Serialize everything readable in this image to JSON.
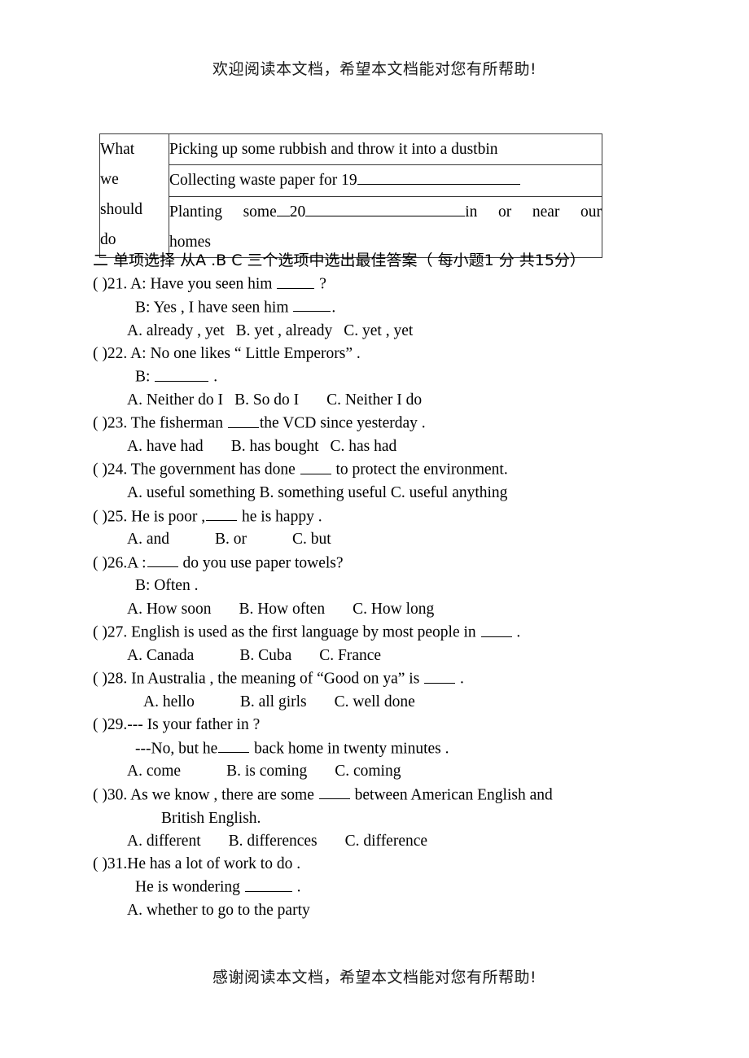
{
  "banner": {
    "top": "欢迎阅读本文档，希望本文档能对您有所帮助!",
    "bottom": "感谢阅读本文档，希望本文档能对您有所帮助!"
  },
  "table": {
    "left_header_lines": [
      "What",
      "we",
      "should",
      "do"
    ],
    "rows": [
      {
        "prefix": "Picking  up some rubbish and throw it into a dustbin",
        "blank": "",
        "suffix": ""
      },
      {
        "prefix": "Collecting waste paper for 19",
        "blank": "",
        "suffix": ""
      },
      {
        "prefix": "Planting  some",
        "number": "20",
        "suffix": "in  or  near  our",
        "second_line": "homes"
      }
    ]
  },
  "section": {
    "heading": "二 单项选择 从A .B C 三个选项中选出最佳答案（ 每小题1 分 共15分）"
  },
  "questions": [
    {
      "num": "21",
      "marker": "(  )21.",
      "stem": "A: Have you seen him",
      "stem_tail": "?",
      "lines": [
        {
          "indent": 2,
          "text_before": "B: Yes , I have seen him",
          "blank": "u5",
          "text_after": "."
        }
      ],
      "options": [
        "A. already , yet",
        "B. yet , already",
        "C. yet , yet"
      ]
    },
    {
      "num": "22",
      "marker": "(  )22.",
      "stem": "A: No one likes “ Little Emperors” .",
      "lines": [
        {
          "indent": 2,
          "text_before": "B:",
          "blank": "u7",
          "text_after": "."
        }
      ],
      "options": [
        "A. Neither do I",
        "B. So do I",
        "C. Neither I do"
      ]
    },
    {
      "num": "23",
      "marker": "(  )23.",
      "stem_before": "The fisherman",
      "stem_after": "the VCD since yesterday .",
      "options": [
        "A. have had",
        "B. has bought",
        "C. has had"
      ]
    },
    {
      "num": "24",
      "marker": "(  )24.",
      "stem_before": "The government has done",
      "stem_after": "to protect the environment.",
      "options": [
        "A. useful something",
        "B. something useful",
        "C. useful anything"
      ]
    },
    {
      "num": "25",
      "marker": "(  )25.",
      "stem_before": "He is poor ,",
      "stem_after": "he is happy .",
      "options": [
        "A. and",
        "B. or",
        "C. but"
      ]
    },
    {
      "num": "26",
      "marker": "(  )26.",
      "stem_before": "A :",
      "stem_after": "do you use paper towels?",
      "lines": [
        {
          "indent": 2,
          "text_before": "B: Often .",
          "blank": "",
          "text_after": ""
        }
      ],
      "options": [
        "A. How soon",
        "B. How often",
        "C. How long"
      ]
    },
    {
      "num": "27",
      "marker": "(  )27.",
      "stem_before": "English is used as the first language by most people in",
      "stem_after": ".",
      "options": [
        "A. Canada",
        "B. Cuba",
        "C. France"
      ]
    },
    {
      "num": "28",
      "marker": "(  )28.",
      "stem_before": "In Australia , the meaning of “Good on ya” is",
      "stem_after": ".",
      "options": [
        "A. hello",
        "B. all girls",
        "C. well done"
      ]
    },
    {
      "num": "29",
      "marker": "(  )29.",
      "stem": "--- Is your father in ?",
      "lines": [
        {
          "indent": 3,
          "text_before": "---No, but he",
          "blank": "u4",
          "text_after": "back home in twenty minutes ."
        }
      ],
      "options": [
        "A. come",
        "B. is coming",
        "C. coming"
      ]
    },
    {
      "num": "30",
      "marker": "(  )30.",
      "stem_before": "As we know , there are some",
      "stem_after": "between American English and",
      "continuation": "British English.",
      "options": [
        "A. different",
        "B. differences",
        "C. difference"
      ]
    },
    {
      "num": "31",
      "marker": "(  )31.",
      "stem": "He has a lot of  work to do .",
      "lines": [
        {
          "indent": 2,
          "text_before": "He is wondering",
          "blank": "u6",
          "text_after": "."
        }
      ],
      "options": [
        "A. whether to go to the party"
      ]
    }
  ]
}
